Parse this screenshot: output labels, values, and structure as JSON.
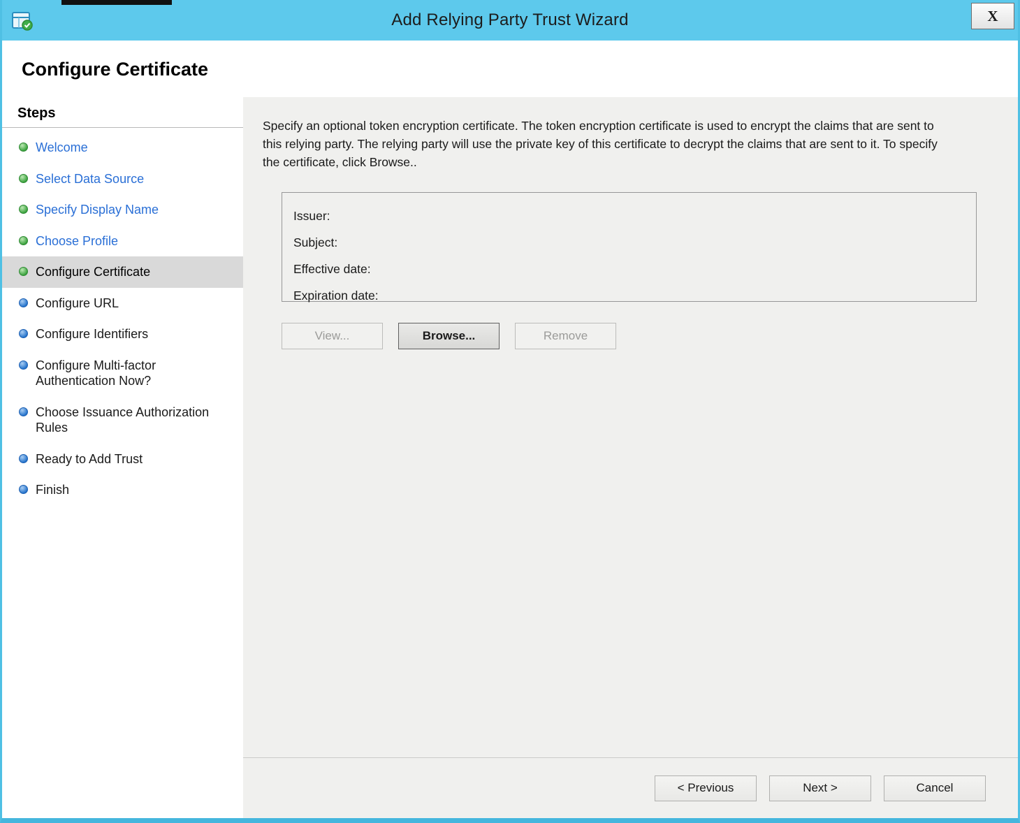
{
  "window": {
    "title": "Add Relying Party Trust Wizard",
    "close": "X"
  },
  "page": {
    "title": "Configure Certificate"
  },
  "steps": {
    "heading": "Steps",
    "items": [
      {
        "label": "Welcome",
        "state": "done"
      },
      {
        "label": "Select Data Source",
        "state": "done"
      },
      {
        "label": "Specify Display Name",
        "state": "done"
      },
      {
        "label": "Choose Profile",
        "state": "done"
      },
      {
        "label": "Configure Certificate",
        "state": "current"
      },
      {
        "label": "Configure URL",
        "state": "todo"
      },
      {
        "label": "Configure Identifiers",
        "state": "todo"
      },
      {
        "label": "Configure Multi-factor Authentication Now?",
        "state": "todo"
      },
      {
        "label": "Choose Issuance Authorization Rules",
        "state": "todo"
      },
      {
        "label": "Ready to Add Trust",
        "state": "todo"
      },
      {
        "label": "Finish",
        "state": "todo"
      }
    ]
  },
  "content": {
    "description": "Specify an optional token encryption certificate.  The token encryption certificate is used to encrypt the claims that are sent to this relying party.  The relying party will use the private key of this certificate to decrypt the claims that are sent to it.  To specify the certificate, click Browse..",
    "certificate": {
      "fields": [
        "Issuer:",
        "Subject:",
        "Effective date:",
        "Expiration date:"
      ]
    },
    "buttons": {
      "view": "View...",
      "browse": "Browse...",
      "remove": "Remove"
    }
  },
  "footer": {
    "previous": "< Previous",
    "next": "Next >",
    "cancel": "Cancel"
  },
  "colors": {
    "titlebar": "#5dc9ec",
    "completed_dot": "#37a03a",
    "pending_dot": "#2171cb",
    "link": "#2a6fd6",
    "current_step_highlight": "#d9d9d9",
    "panel_background": "#f0f0ee"
  }
}
